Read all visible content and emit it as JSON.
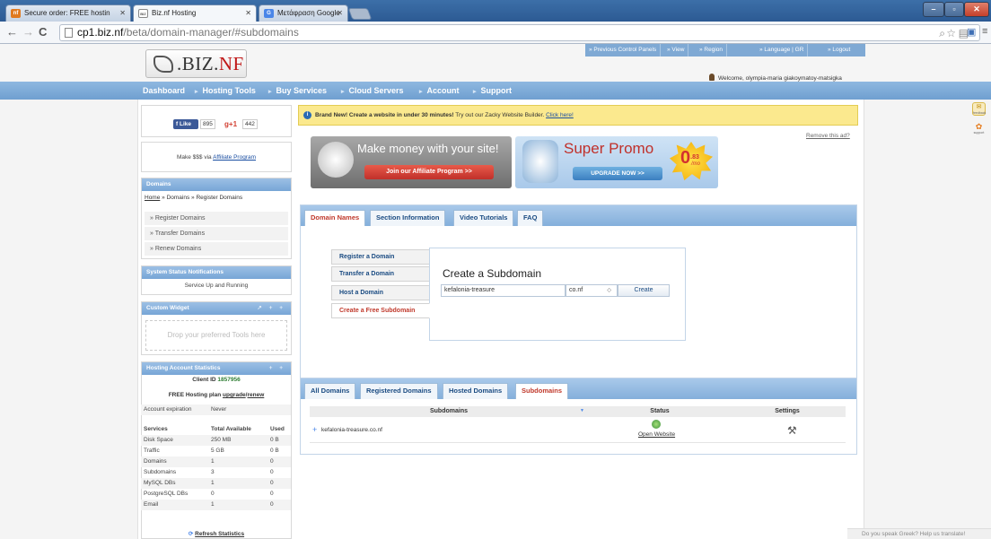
{
  "browser": {
    "tabs": [
      {
        "label": "Secure order: FREE hostin",
        "favicon": "nf"
      },
      {
        "label": "Biz.nf Hosting",
        "favicon": "BIZ"
      },
      {
        "label": "Μετάφραση Google",
        "favicon": "G"
      }
    ],
    "url_host": "cp1.biz.nf",
    "url_path": "/beta/domain-manager/#subdomains",
    "icons": [
      "back-icon",
      "forward-icon",
      "reload-icon",
      "search-icon",
      "star-icon",
      "extensions-icon",
      "menu-icon"
    ]
  },
  "site": {
    "logo_text_a": ".BIZ.",
    "logo_text_b": "NF",
    "top_links": [
      "» Previous Control Panels",
      "» View",
      "» Region",
      "» Language | GR",
      "» Logout"
    ],
    "welcome": "Welcome, olympia-maria giakoymatoy-matsigka",
    "nav": [
      "Dashboard",
      "Hosting Tools",
      "Buy Services",
      "Cloud Servers",
      "Account",
      "Support"
    ]
  },
  "sidebar": {
    "fb_like": "Like",
    "fb_count": "895",
    "gplus_count": "442",
    "gplus_label": "+1",
    "affiliate_prefix": "Make $$$ via ",
    "affiliate_link": "Affiliate Program",
    "domains_title": "Domains",
    "breadcrumb": "Home » Domains » Register Domains",
    "breadcrumb_home": "Home",
    "breadcrumb_rest": " » Domains » Register Domains",
    "domain_items": [
      "» Register Domains",
      "» Transfer Domains",
      "» Renew Domains"
    ],
    "status_title": "System Status Notifications",
    "status_text": "Service Up and Running",
    "widget_title": "Custom Widget",
    "widget_placeholder": "Drop your preferred Tools here",
    "stats_title": "Hosting Account Statistics",
    "client_id_label": "Client ID ",
    "client_id": "1857956",
    "plan_prefix": "FREE Hosting plan ",
    "plan_upgrade": "upgrade",
    "plan_renew": "renew",
    "expiration_label": "Account expiration",
    "expiration_value": "Never",
    "stats_headers": [
      "Services",
      "Total Available",
      "Used"
    ],
    "stats_rows": [
      [
        "Disk Space",
        "250 MB",
        "0 B"
      ],
      [
        "Traffic",
        "5 GB",
        "0 B"
      ],
      [
        "Domains",
        "1",
        "0"
      ],
      [
        "Subdomains",
        "3",
        "0"
      ],
      [
        "MySQL DBs",
        "1",
        "0"
      ],
      [
        "PostgreSQL DBs",
        "0",
        "0"
      ],
      [
        "Email",
        "1",
        "0"
      ]
    ],
    "refresh": "Refresh Statistics"
  },
  "main": {
    "notice_bold": "Brand New! Create a website in under 30 minutes!",
    "notice_text": " Try out our Zacky Website Builder. ",
    "notice_link": "Click here!",
    "remove_ad": "Remove this ad?",
    "banner1_title": "Make money with your site!",
    "banner1_button": "Join our Affiliate Program >>",
    "banner2_title": "Super Promo",
    "banner2_button": "UPGRADE NOW >>",
    "banner2_price_main": "0",
    "banner2_price_cents": ".83",
    "banner2_price_unit": "/mo",
    "top_tabs": [
      "Domain Names",
      "Section Information",
      "Video Tutorials",
      "FAQ"
    ],
    "subnav": [
      "Register a Domain",
      "Transfer a Domain",
      "Host a Domain",
      "Create a Free Subdomain"
    ],
    "create_title": "Create a Subdomain",
    "subdomain_value": "kefalonia-treasure",
    "zone_value": "co.nf",
    "zone_arrow": "◇",
    "create_button": "Create",
    "bottom_tabs": [
      "All Domains",
      "Registered Domains",
      "Hosted Domains",
      "Subdomains"
    ],
    "grid_headers": [
      "Subdomains",
      "Status",
      "Settings"
    ],
    "grid_row": {
      "name": "kefalonia-treasure.co.nf",
      "status_link": "Open Website",
      "expand": "+"
    }
  },
  "right": {
    "feedback": "feedback",
    "support": "support",
    "translate": "Do you speak Greek? Help us translate!"
  },
  "colors": {
    "nav_blue": "#7fa9d4",
    "notice_yellow": "#fbe98e",
    "link_blue": "#1a4ea1",
    "active_red": "#c0392b"
  }
}
